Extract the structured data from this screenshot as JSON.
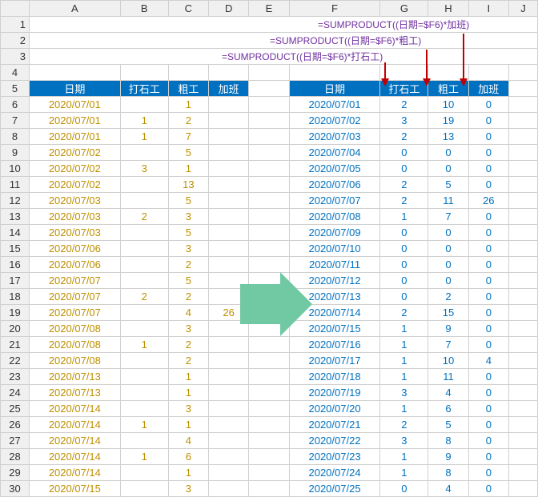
{
  "colHeaders": [
    "A",
    "B",
    "C",
    "D",
    "E",
    "F",
    "G",
    "H",
    "I",
    "J"
  ],
  "formulas": {
    "f1": "=SUMPRODUCT((日期=$F6)*加班)",
    "f2": "=SUMPRODUCT((日期=$F6)*粗工)",
    "f3": "=SUMPRODUCT((日期=$F6)*打石工)"
  },
  "leftHeaders": {
    "date": "日期",
    "c1": "打石工",
    "c2": "粗工",
    "c3": "加班"
  },
  "rightHeaders": {
    "date": "日期",
    "c1": "打石工",
    "c2": "粗工",
    "c3": "加班"
  },
  "left": [
    {
      "r": 6,
      "date": "2020/07/01",
      "v1": "",
      "v2": "1",
      "v3": ""
    },
    {
      "r": 7,
      "date": "2020/07/01",
      "v1": "1",
      "v2": "2",
      "v3": ""
    },
    {
      "r": 8,
      "date": "2020/07/01",
      "v1": "1",
      "v2": "7",
      "v3": ""
    },
    {
      "r": 9,
      "date": "2020/07/02",
      "v1": "",
      "v2": "5",
      "v3": ""
    },
    {
      "r": 10,
      "date": "2020/07/02",
      "v1": "3",
      "v2": "1",
      "v3": ""
    },
    {
      "r": 11,
      "date": "2020/07/02",
      "v1": "",
      "v2": "13",
      "v3": ""
    },
    {
      "r": 12,
      "date": "2020/07/03",
      "v1": "",
      "v2": "5",
      "v3": ""
    },
    {
      "r": 13,
      "date": "2020/07/03",
      "v1": "2",
      "v2": "3",
      "v3": ""
    },
    {
      "r": 14,
      "date": "2020/07/03",
      "v1": "",
      "v2": "5",
      "v3": ""
    },
    {
      "r": 15,
      "date": "2020/07/06",
      "v1": "",
      "v2": "3",
      "v3": ""
    },
    {
      "r": 16,
      "date": "2020/07/06",
      "v1": "",
      "v2": "2",
      "v3": ""
    },
    {
      "r": 17,
      "date": "2020/07/07",
      "v1": "",
      "v2": "5",
      "v3": ""
    },
    {
      "r": 18,
      "date": "2020/07/07",
      "v1": "2",
      "v2": "2",
      "v3": ""
    },
    {
      "r": 19,
      "date": "2020/07/07",
      "v1": "",
      "v2": "4",
      "v3": "26"
    },
    {
      "r": 20,
      "date": "2020/07/08",
      "v1": "",
      "v2": "3",
      "v3": ""
    },
    {
      "r": 21,
      "date": "2020/07/08",
      "v1": "1",
      "v2": "2",
      "v3": ""
    },
    {
      "r": 22,
      "date": "2020/07/08",
      "v1": "",
      "v2": "2",
      "v3": ""
    },
    {
      "r": 23,
      "date": "2020/07/13",
      "v1": "",
      "v2": "1",
      "v3": ""
    },
    {
      "r": 24,
      "date": "2020/07/13",
      "v1": "",
      "v2": "1",
      "v3": ""
    },
    {
      "r": 25,
      "date": "2020/07/14",
      "v1": "",
      "v2": "3",
      "v3": ""
    },
    {
      "r": 26,
      "date": "2020/07/14",
      "v1": "1",
      "v2": "1",
      "v3": ""
    },
    {
      "r": 27,
      "date": "2020/07/14",
      "v1": "",
      "v2": "4",
      "v3": ""
    },
    {
      "r": 28,
      "date": "2020/07/14",
      "v1": "1",
      "v2": "6",
      "v3": ""
    },
    {
      "r": 29,
      "date": "2020/07/14",
      "v1": "",
      "v2": "1",
      "v3": ""
    },
    {
      "r": 30,
      "date": "2020/07/15",
      "v1": "",
      "v2": "3",
      "v3": ""
    }
  ],
  "right": [
    {
      "date": "2020/07/01",
      "v1": "2",
      "v2": "10",
      "v3": "0"
    },
    {
      "date": "2020/07/02",
      "v1": "3",
      "v2": "19",
      "v3": "0"
    },
    {
      "date": "2020/07/03",
      "v1": "2",
      "v2": "13",
      "v3": "0"
    },
    {
      "date": "2020/07/04",
      "v1": "0",
      "v2": "0",
      "v3": "0"
    },
    {
      "date": "2020/07/05",
      "v1": "0",
      "v2": "0",
      "v3": "0"
    },
    {
      "date": "2020/07/06",
      "v1": "2",
      "v2": "5",
      "v3": "0"
    },
    {
      "date": "2020/07/07",
      "v1": "2",
      "v2": "11",
      "v3": "26"
    },
    {
      "date": "2020/07/08",
      "v1": "1",
      "v2": "7",
      "v3": "0"
    },
    {
      "date": "2020/07/09",
      "v1": "0",
      "v2": "0",
      "v3": "0"
    },
    {
      "date": "2020/07/10",
      "v1": "0",
      "v2": "0",
      "v3": "0"
    },
    {
      "date": "2020/07/11",
      "v1": "0",
      "v2": "0",
      "v3": "0"
    },
    {
      "date": "2020/07/12",
      "v1": "0",
      "v2": "0",
      "v3": "0"
    },
    {
      "date": "2020/07/13",
      "v1": "0",
      "v2": "2",
      "v3": "0"
    },
    {
      "date": "2020/07/14",
      "v1": "2",
      "v2": "15",
      "v3": "0"
    },
    {
      "date": "2020/07/15",
      "v1": "1",
      "v2": "9",
      "v3": "0"
    },
    {
      "date": "2020/07/16",
      "v1": "1",
      "v2": "7",
      "v3": "0"
    },
    {
      "date": "2020/07/17",
      "v1": "1",
      "v2": "10",
      "v3": "4"
    },
    {
      "date": "2020/07/18",
      "v1": "1",
      "v2": "11",
      "v3": "0"
    },
    {
      "date": "2020/07/19",
      "v1": "3",
      "v2": "4",
      "v3": "0"
    },
    {
      "date": "2020/07/20",
      "v1": "1",
      "v2": "6",
      "v3": "0"
    },
    {
      "date": "2020/07/21",
      "v1": "2",
      "v2": "5",
      "v3": "0"
    },
    {
      "date": "2020/07/22",
      "v1": "3",
      "v2": "8",
      "v3": "0"
    },
    {
      "date": "2020/07/23",
      "v1": "1",
      "v2": "9",
      "v3": "0"
    },
    {
      "date": "2020/07/24",
      "v1": "1",
      "v2": "8",
      "v3": "0"
    },
    {
      "date": "2020/07/25",
      "v1": "0",
      "v2": "4",
      "v3": "0"
    }
  ]
}
